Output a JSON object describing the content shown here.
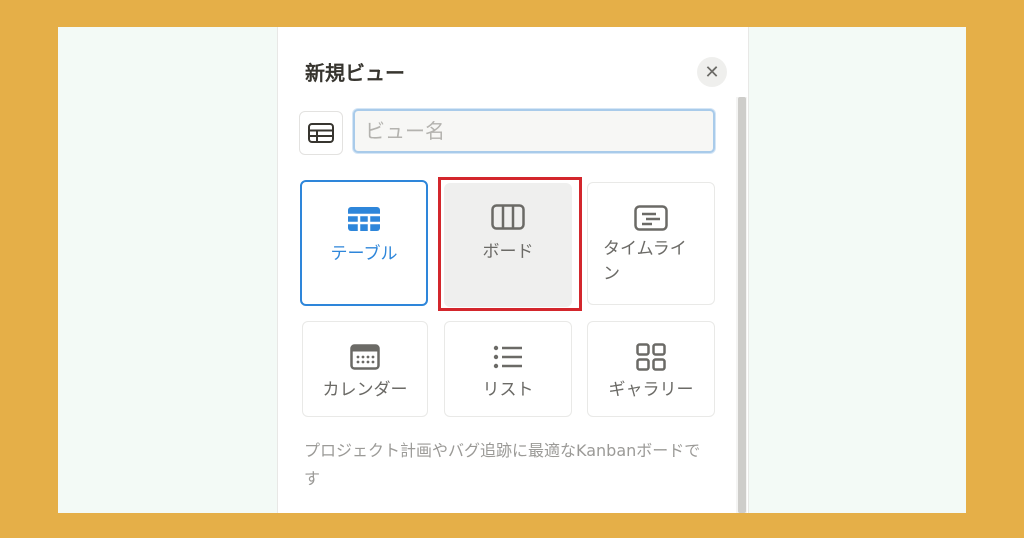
{
  "dialog": {
    "title": "新規ビュー",
    "close_glyph": "✕",
    "name_input": {
      "placeholder": "ビュー名",
      "value": ""
    },
    "view_types": [
      {
        "id": "table",
        "label": "テーブル",
        "icon": "table-icon",
        "state": "selected"
      },
      {
        "id": "board",
        "label": "ボード",
        "icon": "board-columns-icon",
        "state": "hover"
      },
      {
        "id": "timeline",
        "label": "タイムライン",
        "icon": "timeline-icon",
        "state": "normal"
      },
      {
        "id": "calendar",
        "label": "カレンダー",
        "icon": "calendar-icon",
        "state": "normal"
      },
      {
        "id": "list",
        "label": "リスト",
        "icon": "list-icon",
        "state": "normal"
      },
      {
        "id": "gallery",
        "label": "ギャラリー",
        "icon": "gallery-grid-icon",
        "state": "normal"
      }
    ],
    "description": "プロジェクト計画やバグ追跡に最適なKanbanボードです"
  },
  "colors": {
    "outer_background": "#E5AF48",
    "canvas_background": "#F3FAF6",
    "selected_accent": "#2E86DA",
    "annotation_red": "#D3262C",
    "text_primary": "#37352F",
    "text_secondary": "#6B6A66"
  }
}
